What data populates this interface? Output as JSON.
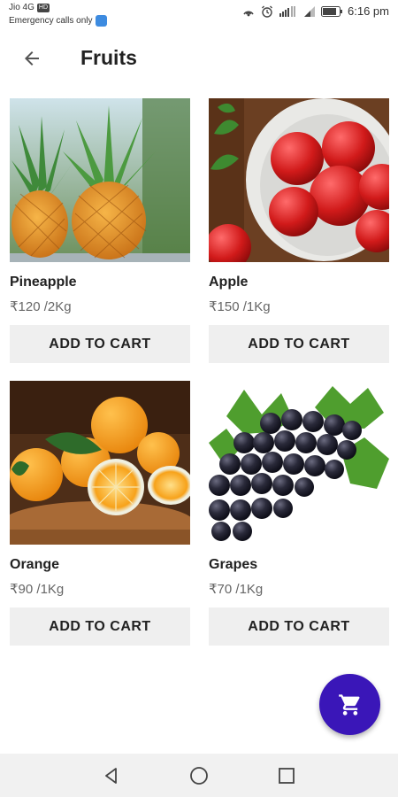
{
  "status_bar": {
    "carrier": "Jio 4G",
    "carrier_badge": "HD",
    "emergency": "Emergency calls only",
    "time": "6:16 pm"
  },
  "app_bar": {
    "title": "Fruits",
    "back_icon": "arrow-back-icon"
  },
  "products": [
    {
      "name": "Pineapple",
      "price": "₹120 /2Kg",
      "button": "ADD TO CART",
      "image": "pineapple-image"
    },
    {
      "name": "Apple",
      "price": "₹150 /1Kg",
      "button": "ADD TO CART",
      "image": "apple-image"
    },
    {
      "name": "Orange",
      "price": "₹90 /1Kg",
      "button": "ADD TO CART",
      "image": "orange-image"
    },
    {
      "name": "Grapes",
      "price": "₹70 /1Kg",
      "button": "ADD TO CART",
      "image": "grapes-image"
    }
  ],
  "fab": {
    "icon": "shopping-cart-icon",
    "color": "#3a16b8"
  },
  "nav_bar": {
    "back_icon": "triangle-back-icon",
    "home_icon": "circle-home-icon",
    "recents_icon": "square-recents-icon"
  }
}
